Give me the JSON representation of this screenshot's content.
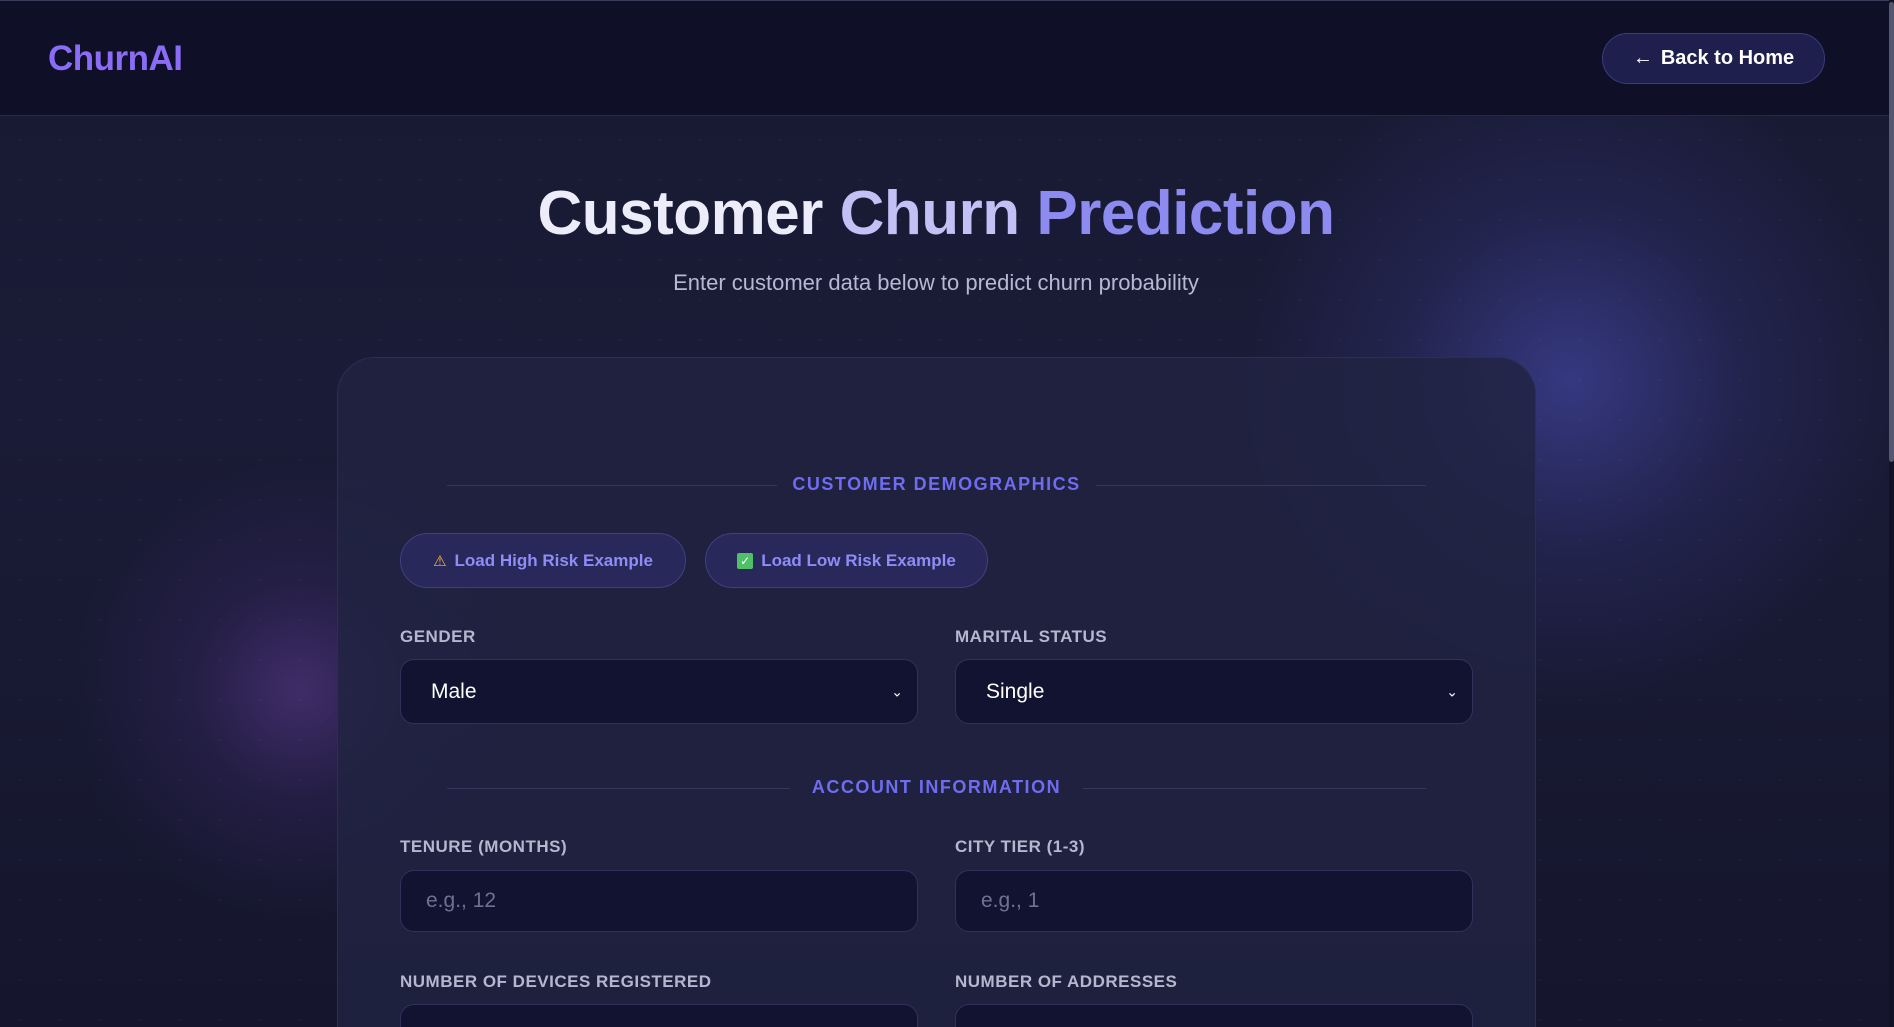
{
  "header": {
    "logo": "ChurnAI",
    "back_button": "Back to Home",
    "back_icon": "arrow-left-icon"
  },
  "hero": {
    "title_word1": "Customer",
    "title_word2": "Churn",
    "title_word3": "Prediction",
    "subtitle": "Enter customer data below to predict churn probability"
  },
  "sections": {
    "demographics": "CUSTOMER DEMOGRAPHICS",
    "account": "ACCOUNT INFORMATION"
  },
  "examples": {
    "high_risk": "Load High Risk Example",
    "high_risk_icon": "warning-icon",
    "low_risk": "Load Low Risk Example",
    "low_risk_icon": "checkmark-icon"
  },
  "fields": {
    "gender": {
      "label": "GENDER",
      "value": "Male"
    },
    "marital_status": {
      "label": "MARITAL STATUS",
      "value": "Single"
    },
    "tenure": {
      "label": "TENURE (MONTHS)",
      "placeholder": "e.g., 12"
    },
    "city_tier": {
      "label": "CITY TIER (1-3)",
      "placeholder": "e.g., 1"
    },
    "devices": {
      "label": "NUMBER OF DEVICES REGISTERED"
    },
    "addresses": {
      "label": "NUMBER OF ADDRESSES"
    }
  },
  "colors": {
    "accent": "#8b6cf6",
    "section_heading": "#6f6cf0",
    "background": "#13142b"
  }
}
